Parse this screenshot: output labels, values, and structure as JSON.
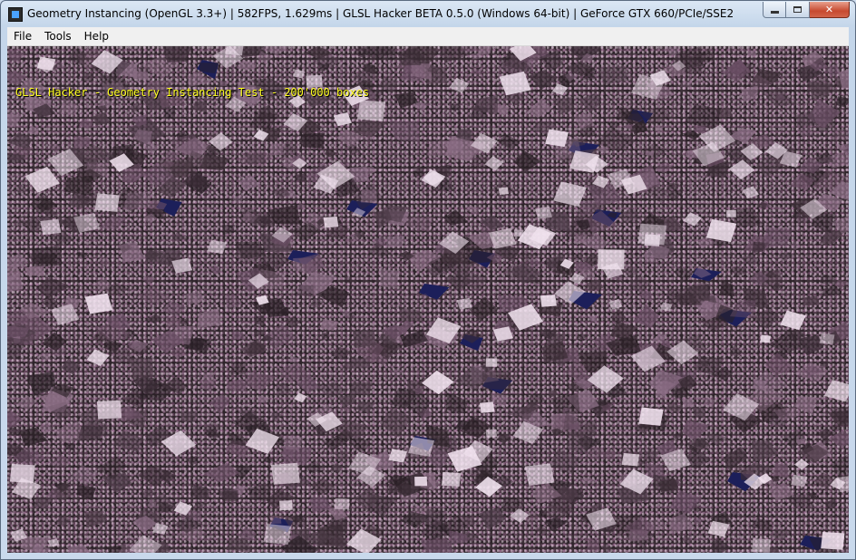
{
  "window": {
    "title": "Geometry Instancing (OpenGL 3.3+) | 582FPS, 1.629ms | GLSL Hacker BETA 0.5.0 (Windows 64-bit) | GeForce GTX 660/PCIe/SSE2",
    "controls": {
      "close_label": "✕"
    }
  },
  "menu": [
    {
      "label": "File"
    },
    {
      "label": "Tools"
    },
    {
      "label": "Help"
    }
  ],
  "viewport": {
    "overlay_text": "GLSL Hacker - Geometry Instancing Test - 200'000 boxes",
    "colors": {
      "overlay": "#ffff20",
      "background_gap": "#1c1f5a",
      "box_light": "#f2e4f0",
      "box_mid": "#6b4f65",
      "box_dark": "#2a2026"
    }
  }
}
